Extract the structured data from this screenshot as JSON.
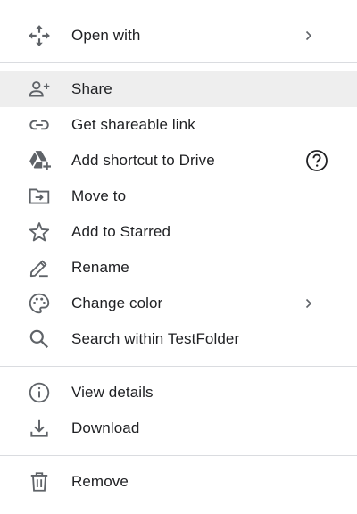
{
  "menu": {
    "open_with": "Open with",
    "share": "Share",
    "get_link": "Get shareable link",
    "add_shortcut": "Add shortcut to Drive",
    "move_to": "Move to",
    "add_starred": "Add to Starred",
    "rename": "Rename",
    "change_color": "Change color",
    "search_within": "Search within TestFolder",
    "view_details": "View details",
    "download": "Download",
    "remove": "Remove"
  },
  "colors": {
    "icon": "#5f6368",
    "text": "#202124",
    "highlight": "#eeeeee",
    "divider": "#dadce0"
  }
}
